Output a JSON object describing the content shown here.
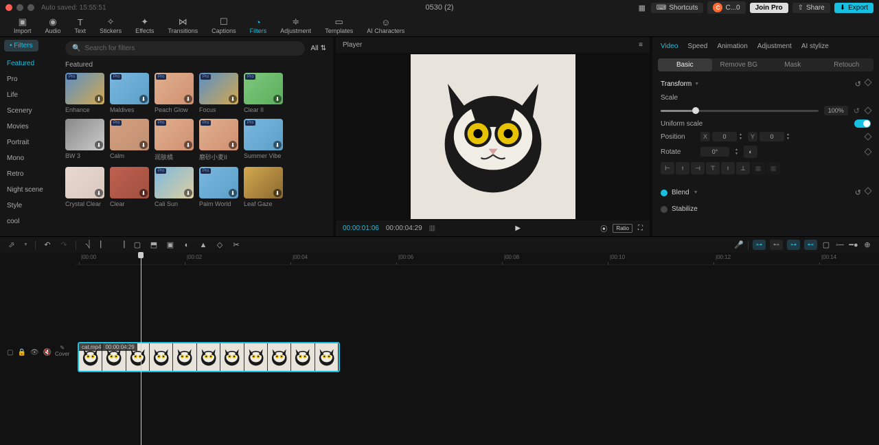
{
  "titlebar": {
    "autosave": "Auto saved: 15:55:51",
    "title": "0530 (2)",
    "shortcuts": "Shortcuts",
    "user": "C...0",
    "joinpro": "Join Pro",
    "share": "Share",
    "export": "Export"
  },
  "nav": {
    "import": "Import",
    "audio": "Audio",
    "text": "Text",
    "stickers": "Stickers",
    "effects": "Effects",
    "transitions": "Transitions",
    "captions": "Captions",
    "filters": "Filters",
    "adjustment": "Adjustment",
    "templates": "Templates",
    "aichars": "AI Characters"
  },
  "sidebar": {
    "chip": "• Filters",
    "items": [
      "Featured",
      "Pro",
      "Life",
      "Scenery",
      "Movies",
      "Portrait",
      "Mono",
      "Retro",
      "Night scene",
      "Style",
      "cool"
    ]
  },
  "gallery": {
    "search_placeholder": "Search for filters",
    "all": "All",
    "section": "Featured",
    "thumbs": [
      {
        "label": "Enhance",
        "pro": true
      },
      {
        "label": "Maldives",
        "pro": true
      },
      {
        "label": "Peach Glow",
        "pro": true
      },
      {
        "label": "Focus",
        "pro": true
      },
      {
        "label": "Clear II",
        "pro": true
      },
      {
        "label": "BW 3",
        "pro": false
      },
      {
        "label": "Calm",
        "pro": true
      },
      {
        "label": "润肤橘",
        "pro": true
      },
      {
        "label": "磨砂小麦II",
        "pro": true
      },
      {
        "label": "Summer Vibe",
        "pro": true
      },
      {
        "label": "Crystal Clear",
        "pro": false
      },
      {
        "label": "Clear",
        "pro": false
      },
      {
        "label": "Cali Sun",
        "pro": true
      },
      {
        "label": "Palm World",
        "pro": true
      },
      {
        "label": "Leaf Gaze",
        "pro": false
      }
    ]
  },
  "player": {
    "title": "Player",
    "tc_current": "00:00:01:06",
    "tc_total": "00:00:04:29",
    "ratio": "Ratio"
  },
  "inspector": {
    "tabs": {
      "video": "Video",
      "speed": "Speed",
      "animation": "Animation",
      "adjustment": "Adjustment",
      "aistylize": "AI stylize"
    },
    "subtabs": {
      "basic": "Basic",
      "removebg": "Remove BG",
      "mask": "Mask",
      "retouch": "Retouch"
    },
    "transform": "Transform",
    "scale": "Scale",
    "scale_val": "100%",
    "uniform": "Uniform scale",
    "position": "Position",
    "x": "X",
    "y": "Y",
    "xval": "0",
    "yval": "0",
    "rotate": "Rotate",
    "rotate_val": "0°",
    "blend": "Blend",
    "stabilize": "Stabilize"
  },
  "timeline": {
    "ticks": [
      "|00:00",
      "|00:02",
      "|00:04",
      "|00:06",
      "|00:08",
      "|00:10",
      "|00:12",
      "|00:14"
    ],
    "clip_name": "cat.mp4",
    "clip_dur": "00:00:04:29",
    "cover": "Cover"
  },
  "colors": {
    "accent": "#17c0e0"
  }
}
